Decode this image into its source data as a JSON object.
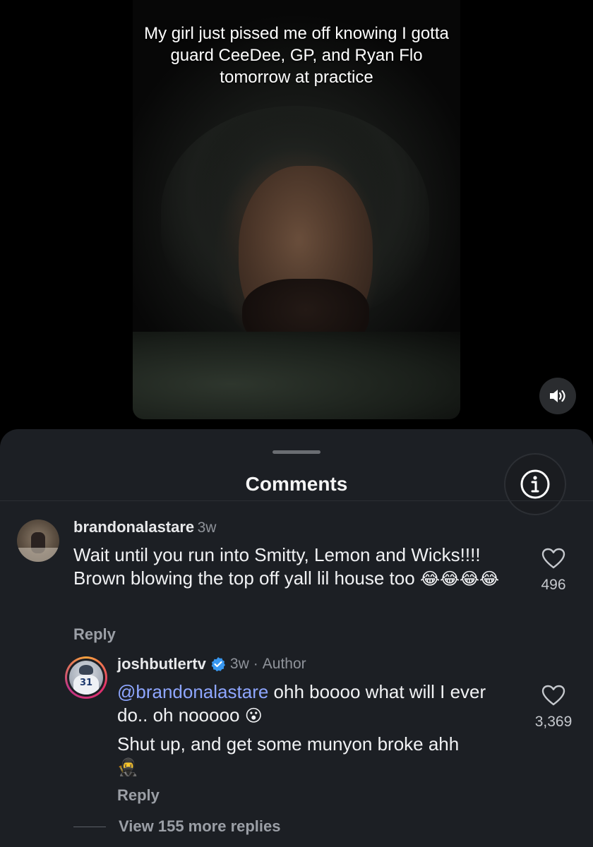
{
  "video": {
    "caption": "My girl just pissed me off knowing I gotta guard CeeDee, GP, and Ryan Flo tomorrow at practice",
    "mute_icon": "speaker-icon"
  },
  "sheet": {
    "title": "Comments",
    "info_icon": "info-icon"
  },
  "comments": [
    {
      "username": "brandonalastare",
      "time": "3w",
      "text": "Wait until you run into Smitty, Lemon and Wicks!!!! Brown blowing the top off yall lil house too",
      "emojis": "😂😂😂😂",
      "reply_label": "Reply",
      "likes": "496"
    },
    {
      "username": "joshbutlertv",
      "time": "3w",
      "author_label": "Author",
      "mention": "@brandonalastare",
      "text": " ohh boooo what will I ever do.. oh nooooo ",
      "emoji_1": "😮",
      "text_2": "Shut up, and get some munyon broke ahh",
      "emoji_2": "🥷",
      "reply_label": "Reply",
      "likes": "3,369",
      "verified_icon": "verified-badge-icon",
      "avatar_number": "31"
    }
  ],
  "view_more": "View 155 more replies",
  "colors": {
    "sheet_bg": "#1c1f24",
    "mention": "#8ea6ff",
    "verified": "#3897f0"
  }
}
